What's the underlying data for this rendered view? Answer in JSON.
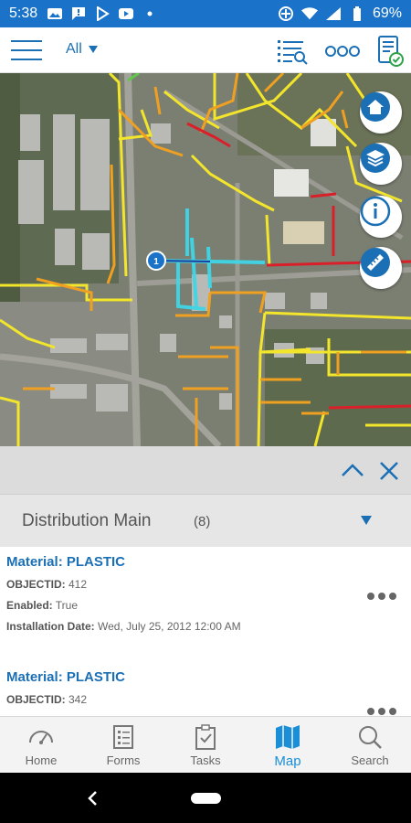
{
  "status_bar": {
    "time": "5:38",
    "battery": "69%",
    "icons_left": [
      "gallery-icon",
      "message-icon",
      "play-store-icon",
      "youtube-icon",
      "dot-icon"
    ],
    "icons_right": [
      "data-saver-icon",
      "wifi-icon",
      "signal-icon",
      "battery-icon"
    ]
  },
  "app_bar": {
    "filter_label": "All",
    "icons": [
      "menu-icon",
      "list-search-icon",
      "more-icon",
      "forms-check-icon"
    ]
  },
  "map": {
    "marker_label": "1",
    "buttons": [
      "home-icon",
      "layers-icon",
      "info-icon",
      "measure-icon"
    ]
  },
  "panel": {
    "group_title": "Distribution Main",
    "group_count": "(8)",
    "results": [
      {
        "title": "Material: PLASTIC",
        "fields": [
          {
            "key": "OBJECTID:",
            "value": " 412"
          },
          {
            "key": "Enabled:",
            "value": " True"
          },
          {
            "key": "Installation Date:",
            "value": " Wed, July 25, 2012 12:00 AM"
          }
        ]
      },
      {
        "title": "Material: PLASTIC",
        "fields": [
          {
            "key": "OBJECTID:",
            "value": " 342"
          }
        ]
      }
    ]
  },
  "bottom_nav": {
    "items": [
      {
        "label": "Home",
        "icon": "gauge-icon"
      },
      {
        "label": "Forms",
        "icon": "form-icon"
      },
      {
        "label": "Tasks",
        "icon": "clipboard-icon"
      },
      {
        "label": "Map",
        "icon": "map-icon",
        "active": true
      },
      {
        "label": "Search",
        "icon": "search-icon"
      }
    ]
  },
  "colors": {
    "accent": "#1a73c8",
    "link": "#1a6fb5",
    "active_nav": "#1a8fd8",
    "pipe_yellow": "#f2e52b",
    "pipe_orange": "#f0a020",
    "pipe_red": "#d9202a",
    "pipe_cyan": "#3fd6e6"
  }
}
